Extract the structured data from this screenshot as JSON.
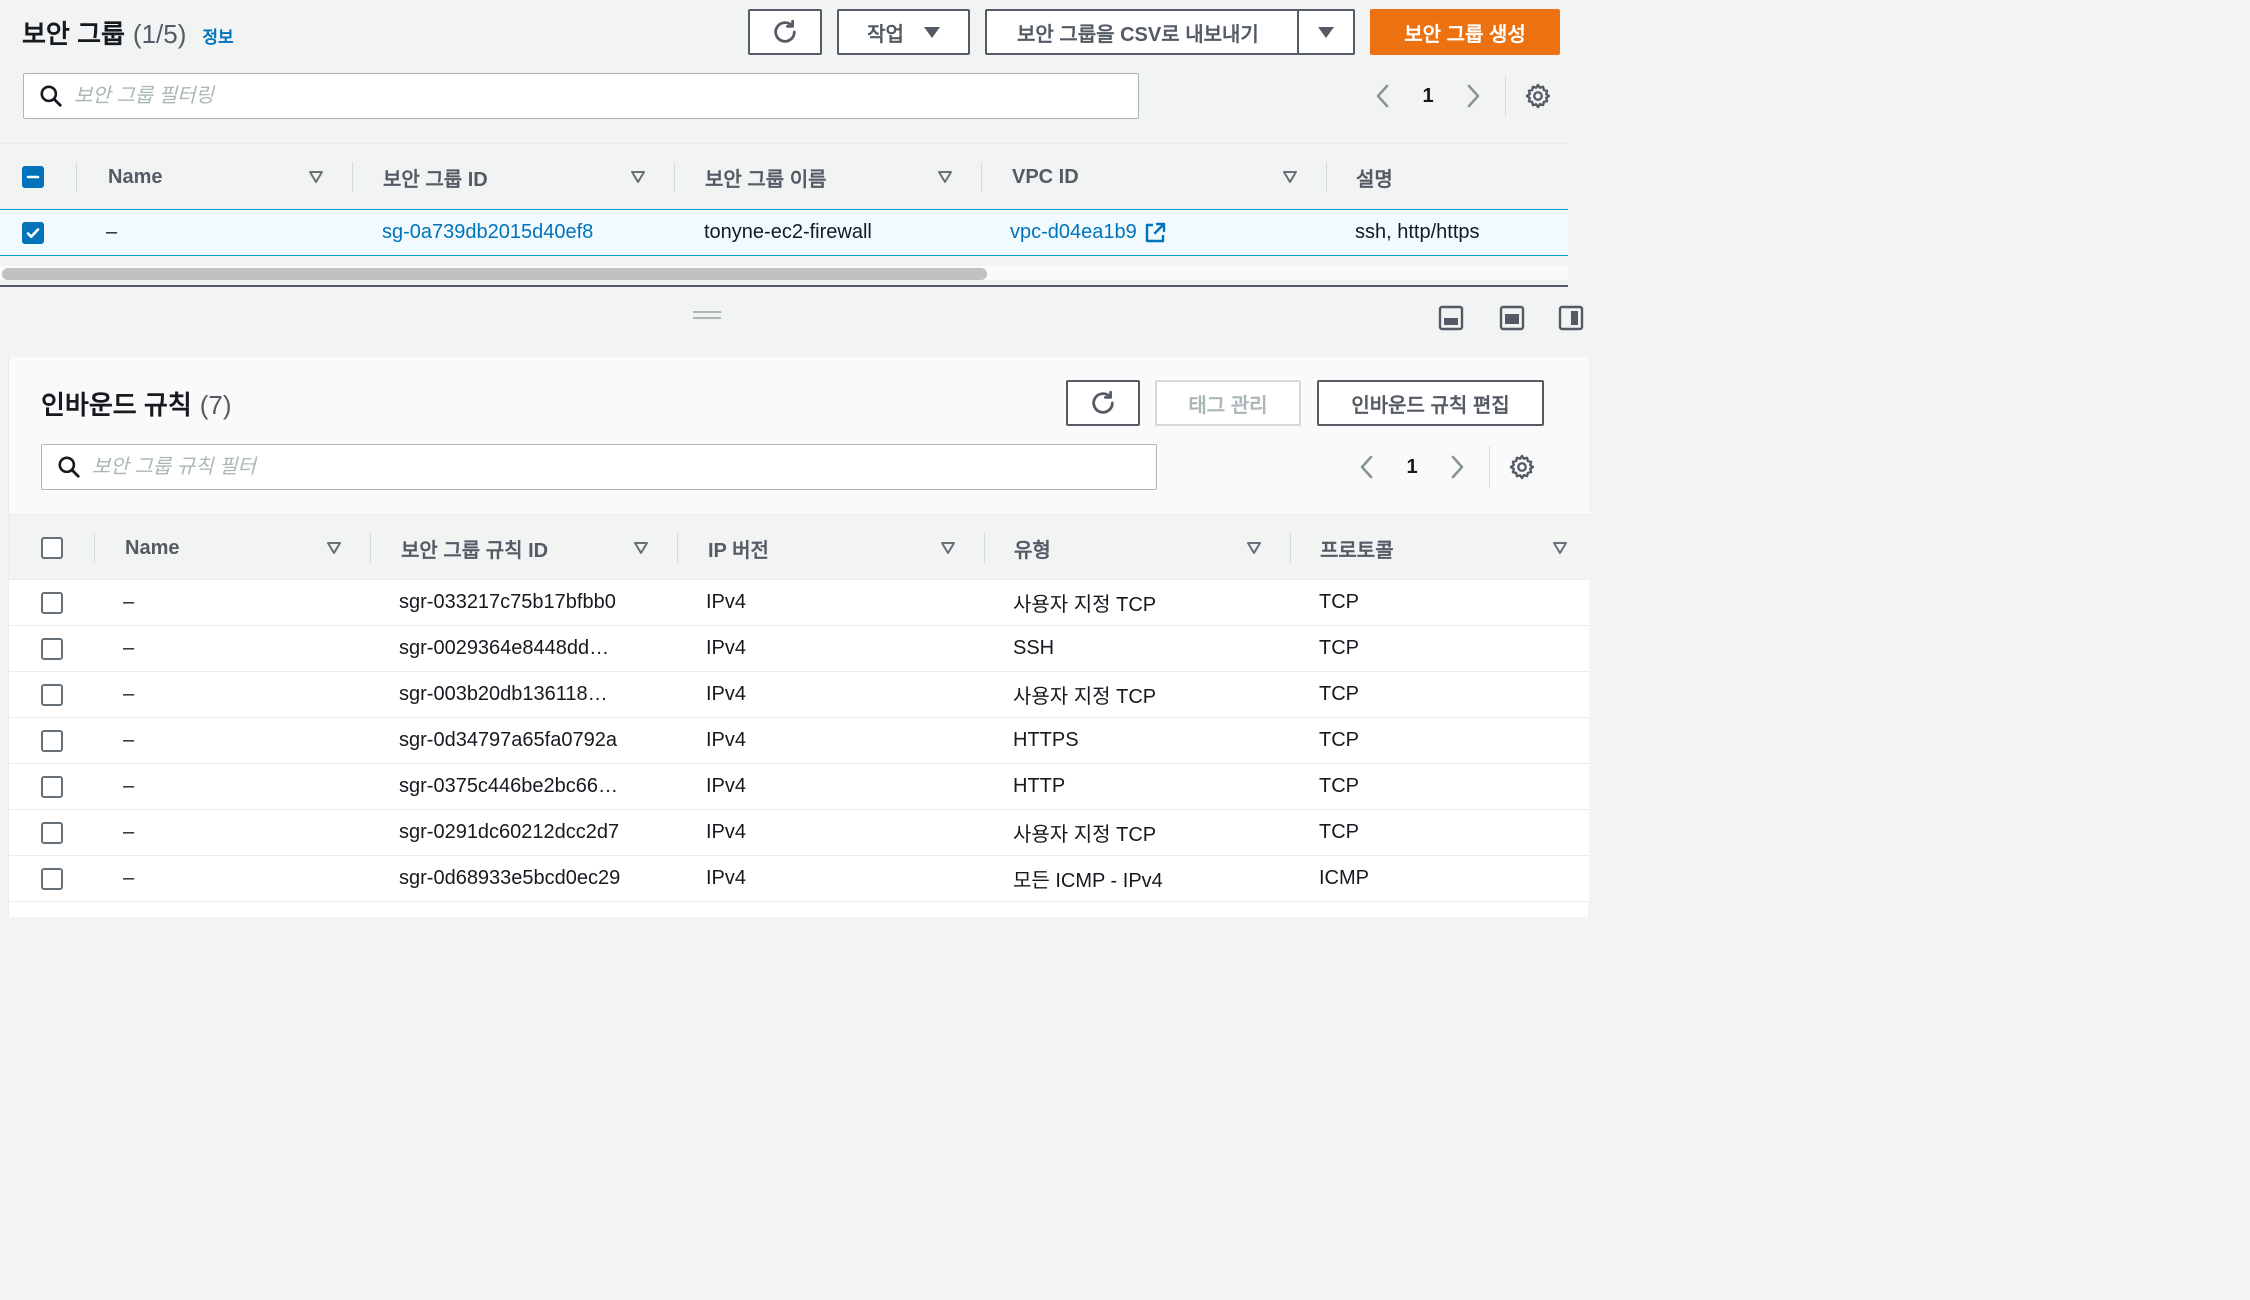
{
  "top": {
    "title": "보안 그룹",
    "count": "(1/5)",
    "info": "정보",
    "actions_label": "작업",
    "export_label": "보안 그룹을 CSV로 내보내기",
    "create_label": "보안 그룹 생성",
    "search_placeholder": "보안 그룹 필터링",
    "page": "1",
    "columns": [
      "Name",
      "보안 그룹 ID",
      "보안 그룹 이름",
      "VPC ID",
      "설명"
    ],
    "rows": [
      {
        "name": "–",
        "sg_id": "sg-0a739db2015d40ef8",
        "sg_name": "tonyne-ec2-firewall",
        "vpc_id": "vpc-d04ea1b9",
        "description": "ssh, http/https",
        "selected": true
      }
    ]
  },
  "bottom": {
    "title": "인바운드 규칙",
    "count": "(7)",
    "manage_tags_label": "태그 관리",
    "edit_rules_label": "인바운드 규칙 편집",
    "search_placeholder": "보안 그룹 규칙 필터",
    "page": "1",
    "columns": [
      "Name",
      "보안 그룹 규칙 ID",
      "IP 버전",
      "유형",
      "프로토콜"
    ],
    "rows": [
      {
        "name": "–",
        "rule_id": "sgr-033217c75b17bfbb0",
        "ip_version": "IPv4",
        "type": "사용자 지정 TCP",
        "protocol": "TCP"
      },
      {
        "name": "–",
        "rule_id": "sgr-0029364e8448dd…",
        "ip_version": "IPv4",
        "type": "SSH",
        "protocol": "TCP"
      },
      {
        "name": "–",
        "rule_id": "sgr-003b20db136118…",
        "ip_version": "IPv4",
        "type": "사용자 지정 TCP",
        "protocol": "TCP"
      },
      {
        "name": "–",
        "rule_id": "sgr-0d34797a65fa0792a",
        "ip_version": "IPv4",
        "type": "HTTPS",
        "protocol": "TCP"
      },
      {
        "name": "–",
        "rule_id": "sgr-0375c446be2bc66…",
        "ip_version": "IPv4",
        "type": "HTTP",
        "protocol": "TCP"
      },
      {
        "name": "–",
        "rule_id": "sgr-0291dc60212dcc2d7",
        "ip_version": "IPv4",
        "type": "사용자 지정 TCP",
        "protocol": "TCP"
      },
      {
        "name": "–",
        "rule_id": "sgr-0d68933e5bcd0ec29",
        "ip_version": "IPv4",
        "type": "모든 ICMP - IPv4",
        "protocol": "ICMP"
      }
    ]
  },
  "colors": {
    "primary": "#ec7211",
    "link": "#0073bb",
    "selected_border": "#00a1c9",
    "selected_bg": "#f1faff",
    "text": "#16191f",
    "muted": "#545b64"
  },
  "icons": [
    "refresh-icon",
    "caret-down-icon",
    "search-icon",
    "chevron-left-icon",
    "chevron-right-icon",
    "gear-icon",
    "sort-icon",
    "external-link-icon",
    "checkbox-icon",
    "panel-layout-icon"
  ]
}
